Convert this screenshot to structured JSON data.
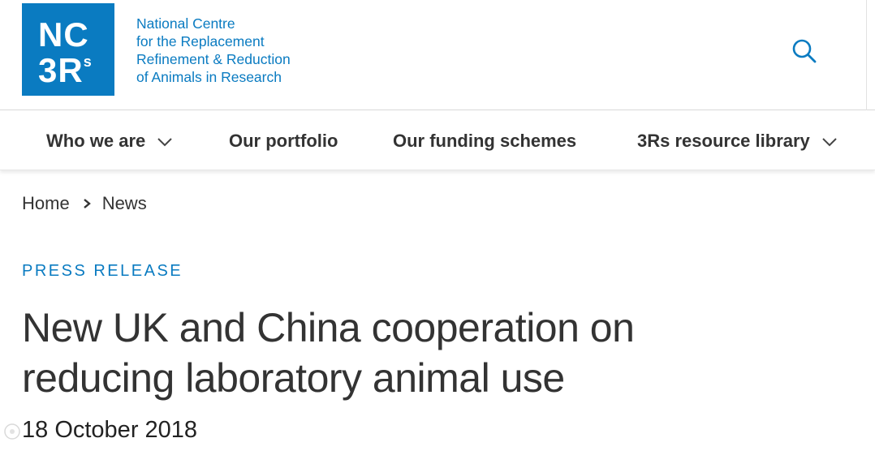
{
  "header": {
    "logo": {
      "line1": "NC",
      "line2": "3R",
      "line2_sup": "s"
    },
    "org_name": [
      "National Centre",
      "for the Replacement",
      "Refinement & Reduction",
      "of Animals in Research"
    ],
    "search_icon": "search-icon"
  },
  "nav": {
    "items": [
      {
        "label": "Who we are",
        "has_dropdown": true
      },
      {
        "label": "Our portfolio",
        "has_dropdown": false
      },
      {
        "label": "Our funding schemes",
        "has_dropdown": false
      },
      {
        "label": "3Rs resource library",
        "has_dropdown": true
      }
    ]
  },
  "breadcrumb": {
    "home": "Home",
    "current": "News"
  },
  "article": {
    "kicker": "PRESS RELEASE",
    "title_line1": "New UK and China cooperation on",
    "title_line2": "reducing laboratory animal use",
    "date": "18 October 2018"
  },
  "colors": {
    "brand_blue": "#0a7bc1",
    "text": "#333333"
  }
}
